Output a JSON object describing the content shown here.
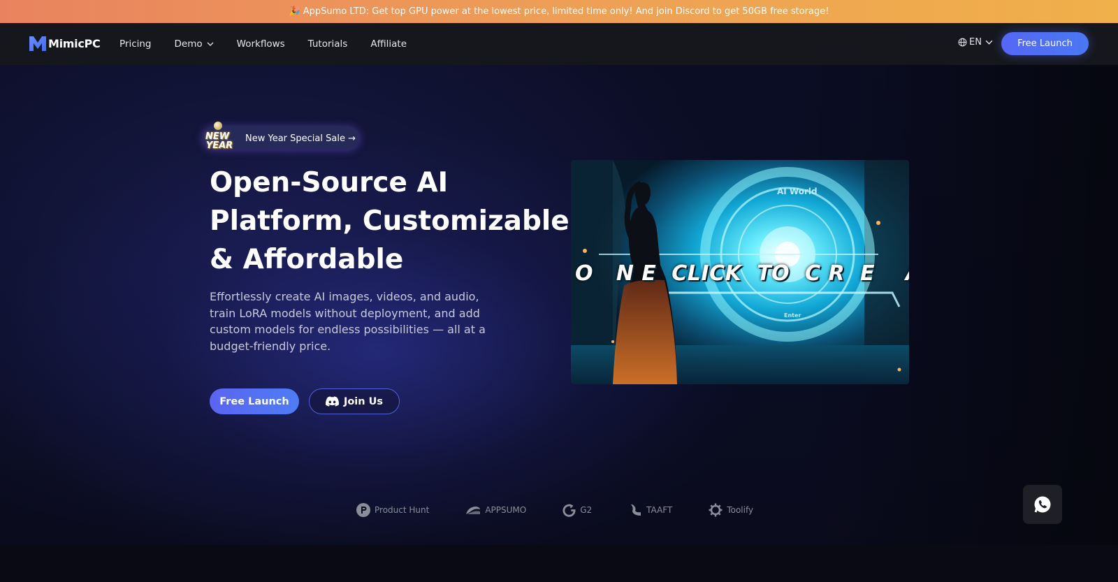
{
  "promo": {
    "icon": "party-popper-icon",
    "text": "AppSumo LTD: Get top GPU power at the lowest price, limited time only! And join Discord to get 50GB free storage!"
  },
  "nav": {
    "brand": "MimicPC",
    "links": [
      "Pricing",
      "Demo",
      "Workflows",
      "Tutorials",
      "Affiliate"
    ],
    "language": "EN",
    "cta": "Free Launch"
  },
  "hero": {
    "sale_badge": [
      "NEW",
      "YEAR"
    ],
    "sale_text": "New Year Special Sale →",
    "title_lines": [
      "Open-Source AI",
      "Platform, Customizable",
      "& Affordable"
    ],
    "subtitle_lines": [
      "Effortlessly create AI images, videos, and audio,",
      "train LoRA models without deployment, and add",
      "custom models for endless possibilities — all at a",
      "budget-friendly price."
    ],
    "primary_cta": "Free Launch",
    "secondary_cta": "Join Us",
    "media": {
      "caption": "O   N E  CLICK  TO  C R  E    A",
      "portal_label": "AI World",
      "portal_sub": "Enter"
    }
  },
  "partners": [
    "Product Hunt",
    "APPSUMO",
    "G2",
    "TAAFT",
    "Toolify"
  ],
  "colors": {
    "accent": "#5567f5",
    "promo_start": "#e9835f",
    "promo_end": "#f0b04a",
    "nav_bg": "#16171d"
  }
}
